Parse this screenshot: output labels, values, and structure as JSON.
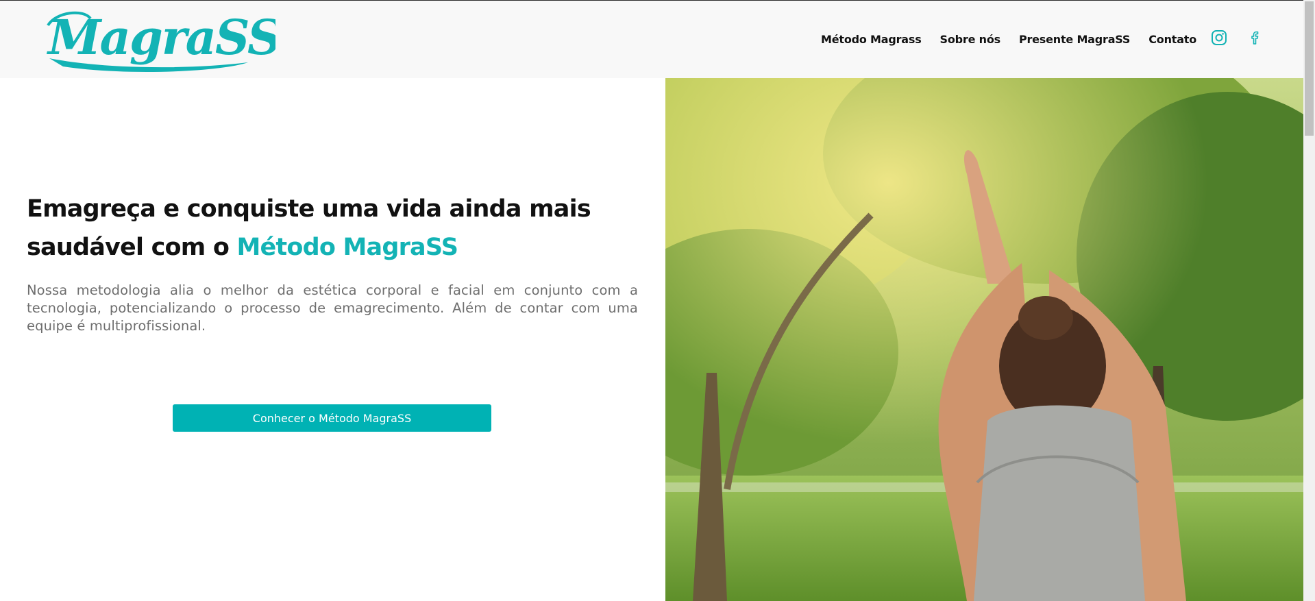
{
  "brand": {
    "logo_text": "MagraSS",
    "color": "#13b3b5"
  },
  "nav": {
    "items": [
      {
        "label": "Método Magrass"
      },
      {
        "label": "Sobre nós"
      },
      {
        "label": "Presente MagraSS"
      },
      {
        "label": "Contato"
      }
    ]
  },
  "social": [
    {
      "icon": "instagram-icon"
    },
    {
      "icon": "facebook-icon"
    }
  ],
  "hero": {
    "title_part1": "Emagreça e conquiste uma vida ainda mais saudável com o",
    "title_accent": "Método MagraSS",
    "text": "Nossa metodologia alia o melhor da estética corporal e facial em conjunto com a tecnologia, potencializando o processo de emagrecimento. Além de contar com uma equipe é multiprofissional.",
    "cta_label": "Conhecer o Método MagraSS"
  },
  "colors": {
    "accent": "#13b3b5",
    "button": "#00b2b4",
    "header_bg": "#f8f8f8",
    "body_text": "#6e6e6e"
  }
}
